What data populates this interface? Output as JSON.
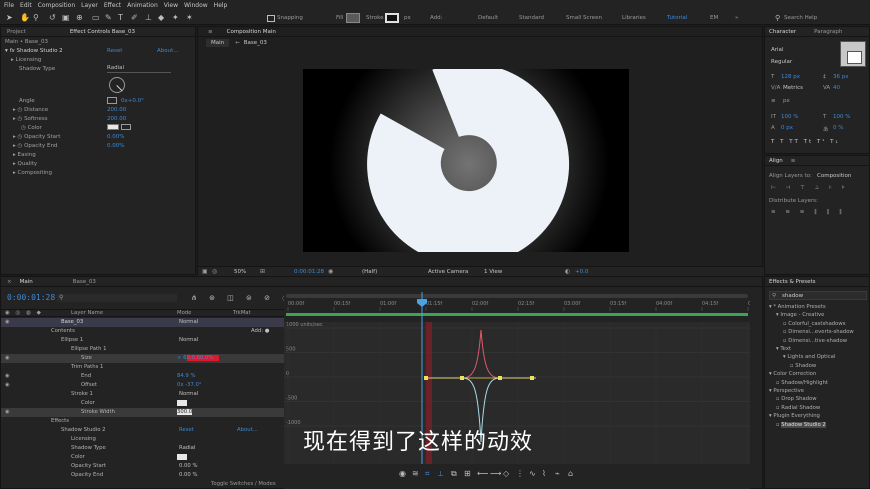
{
  "menu": [
    "File",
    "Edit",
    "Composition",
    "Layer",
    "Effect",
    "Animation",
    "View",
    "Window",
    "Help"
  ],
  "toolbar": {
    "snapping": "Snapping",
    "fill": "Fill",
    "stroke": "Stroke",
    "stroke_px": "px",
    "add": "Add:",
    "workspaces": [
      "Default",
      "Standard",
      "Small Screen",
      "Libraries",
      "Tutorial",
      "EM"
    ],
    "active_workspace": "Tutorial",
    "search_help": "Search Help"
  },
  "project_panel": {
    "tabs": [
      "Project",
      "Effect Controls Base_03"
    ],
    "breadcrumb": "Main • Base_03",
    "effect_name": "Shadow Studio 2",
    "reset": "Reset",
    "about": "About...",
    "rows": [
      {
        "label": "Licensing",
        "value": ""
      },
      {
        "label": "Shadow Type",
        "value": "Radial"
      },
      {
        "label": "Angle",
        "value": "0x+0.0°"
      },
      {
        "label": "Distance",
        "value": "200.00"
      },
      {
        "label": "Softness",
        "value": "200.00"
      },
      {
        "label": "Color",
        "value": ""
      },
      {
        "label": "Opacity Start",
        "value": "0.00%"
      },
      {
        "label": "Opacity End",
        "value": "0.00%"
      },
      {
        "label": "Easing",
        "value": ""
      },
      {
        "label": "Quality",
        "value": ""
      },
      {
        "label": "Compositing",
        "value": ""
      }
    ]
  },
  "composition": {
    "tab": "Composition Main",
    "breadcrumbs": [
      "Main",
      "Base_03"
    ],
    "footer": {
      "zoom": "50%",
      "time": "0:00:01:28",
      "resolution": "(Half)",
      "camera": "Active Camera",
      "views": "1 View",
      "exposure": "+0.0"
    }
  },
  "timeline": {
    "tabs": [
      "Main",
      "Base_03"
    ],
    "timecode": "0:00:01:28",
    "search_placeholder": "",
    "headers": {
      "layer_name": "Layer Name",
      "mode": "Mode",
      "trkmat": "TrkMat"
    },
    "ruler": [
      "00:00f",
      "00:15f",
      "01:00f",
      "01:15f",
      "02:00f",
      "02:15f",
      "03:00f",
      "03:15f",
      "04:00f",
      "04:15f",
      "05:00f"
    ],
    "graph_labels": [
      "1000 units/sec",
      "500",
      "0",
      "-500",
      "-1000"
    ],
    "rows": [
      {
        "name": "Base_03",
        "mode": "Normal",
        "value": ""
      },
      {
        "name": "Contents",
        "mode": "",
        "value": "Add: ●"
      },
      {
        "name": "Ellipse 1",
        "mode": "Normal",
        "value": ""
      },
      {
        "name": "Ellipse Path 1",
        "mode": "",
        "value": ""
      },
      {
        "name": "Size",
        "mode": "",
        "value": "∞ 60.0,60.0%"
      },
      {
        "name": "Trim Paths 1",
        "mode": "",
        "value": ""
      },
      {
        "name": "End",
        "mode": "",
        "value": "84.9 %"
      },
      {
        "name": "Offset",
        "mode": "",
        "value": "0x -37.0°"
      },
      {
        "name": "Stroke 1",
        "mode": "Normal",
        "value": ""
      },
      {
        "name": "Color",
        "mode": "",
        "value": ""
      },
      {
        "name": "Stroke Width",
        "mode": "",
        "value": "300.0"
      },
      {
        "name": "Effects",
        "mode": "",
        "value": ""
      },
      {
        "name": "Shadow Studio 2",
        "mode": "Reset",
        "value": "About..."
      },
      {
        "name": "Licensing",
        "mode": "",
        "value": ""
      },
      {
        "name": "Shadow Type",
        "mode": "Radial",
        "value": ""
      },
      {
        "name": "Color",
        "mode": "",
        "value": ""
      },
      {
        "name": "Opacity Start",
        "mode": "0.00 %",
        "value": ""
      },
      {
        "name": "Opacity End",
        "mode": "0.00 %",
        "value": ""
      }
    ],
    "toggle_label": "Toggle Switches / Modes"
  },
  "subtitle": "现在得到了这样的动效",
  "character_panel": {
    "tabs": [
      "Character",
      "Paragraph"
    ],
    "font": "Arial",
    "style": "Regular",
    "size": "128 px",
    "leading": "36 px",
    "kerning": "Metrics",
    "tracking": "40",
    "vscale": "100 %",
    "hscale": "100 %",
    "baseline": "0 px",
    "tsume": "0 %",
    "stroke_px": "px"
  },
  "align_panel": {
    "title": "Align",
    "align_to_label": "Align Layers to:",
    "align_to_value": "Composition",
    "distribute_label": "Distribute Layers:"
  },
  "effects_panel": {
    "title": "Effects & Presets",
    "search_value": "shadow",
    "tree": [
      {
        "label": "* Animation Presets",
        "indent": 0
      },
      {
        "label": "Image - Creative",
        "indent": 1
      },
      {
        "label": "Colorful_castshadows",
        "indent": 2
      },
      {
        "label": "Dimensi...everts-shadow",
        "indent": 2
      },
      {
        "label": "Dimensi...tive-shadow",
        "indent": 2
      },
      {
        "label": "Text",
        "indent": 1
      },
      {
        "label": "Lights and Optical",
        "indent": 2
      },
      {
        "label": "Shadow",
        "indent": 3
      },
      {
        "label": "Color Correction",
        "indent": 0
      },
      {
        "label": "Shadow/Highlight",
        "indent": 1
      },
      {
        "label": "Perspective",
        "indent": 0
      },
      {
        "label": "Drop Shadow",
        "indent": 1
      },
      {
        "label": "Radial Shadow",
        "indent": 1
      },
      {
        "label": "Plugin Everything",
        "indent": 0
      },
      {
        "label": "Shadow Studio 2",
        "indent": 1
      }
    ]
  },
  "colors": {
    "accent": "#3c8ad8",
    "playhead": "#4aa3e0",
    "curve_red": "#e05a6a",
    "curve_cyan": "#a8dde8",
    "size_swatch": "#e0182a",
    "work_area": "#3aa655"
  }
}
